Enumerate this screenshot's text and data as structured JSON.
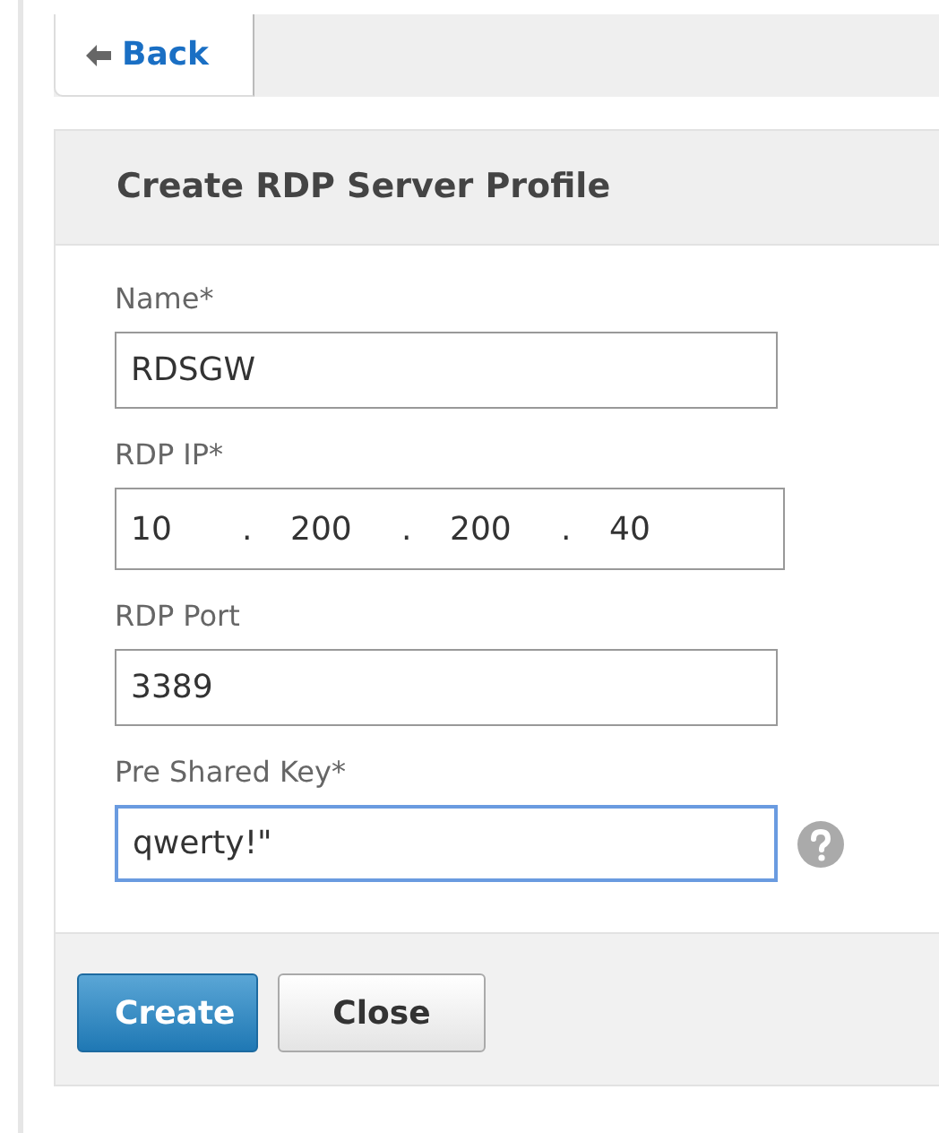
{
  "back_tab": {
    "label": "Back"
  },
  "panel": {
    "title": "Create RDP Server Profile",
    "fields": [
      {
        "kind": "text",
        "label": "Name*",
        "value": "RDSGW",
        "focused": false,
        "help": false
      },
      {
        "kind": "ip",
        "label": "RDP IP*",
        "octets": [
          "10",
          "200",
          "200",
          "40"
        ],
        "separator": ".",
        "focused": false,
        "help": false
      },
      {
        "kind": "text",
        "label": "RDP Port",
        "value": "3389",
        "focused": false,
        "help": false
      },
      {
        "kind": "text",
        "label": "Pre Shared Key*",
        "value": "qwerty!\"",
        "focused": true,
        "help": true
      }
    ],
    "buttons": [
      {
        "label": "Create",
        "primary": true
      },
      {
        "label": "Close",
        "primary": false
      }
    ]
  }
}
